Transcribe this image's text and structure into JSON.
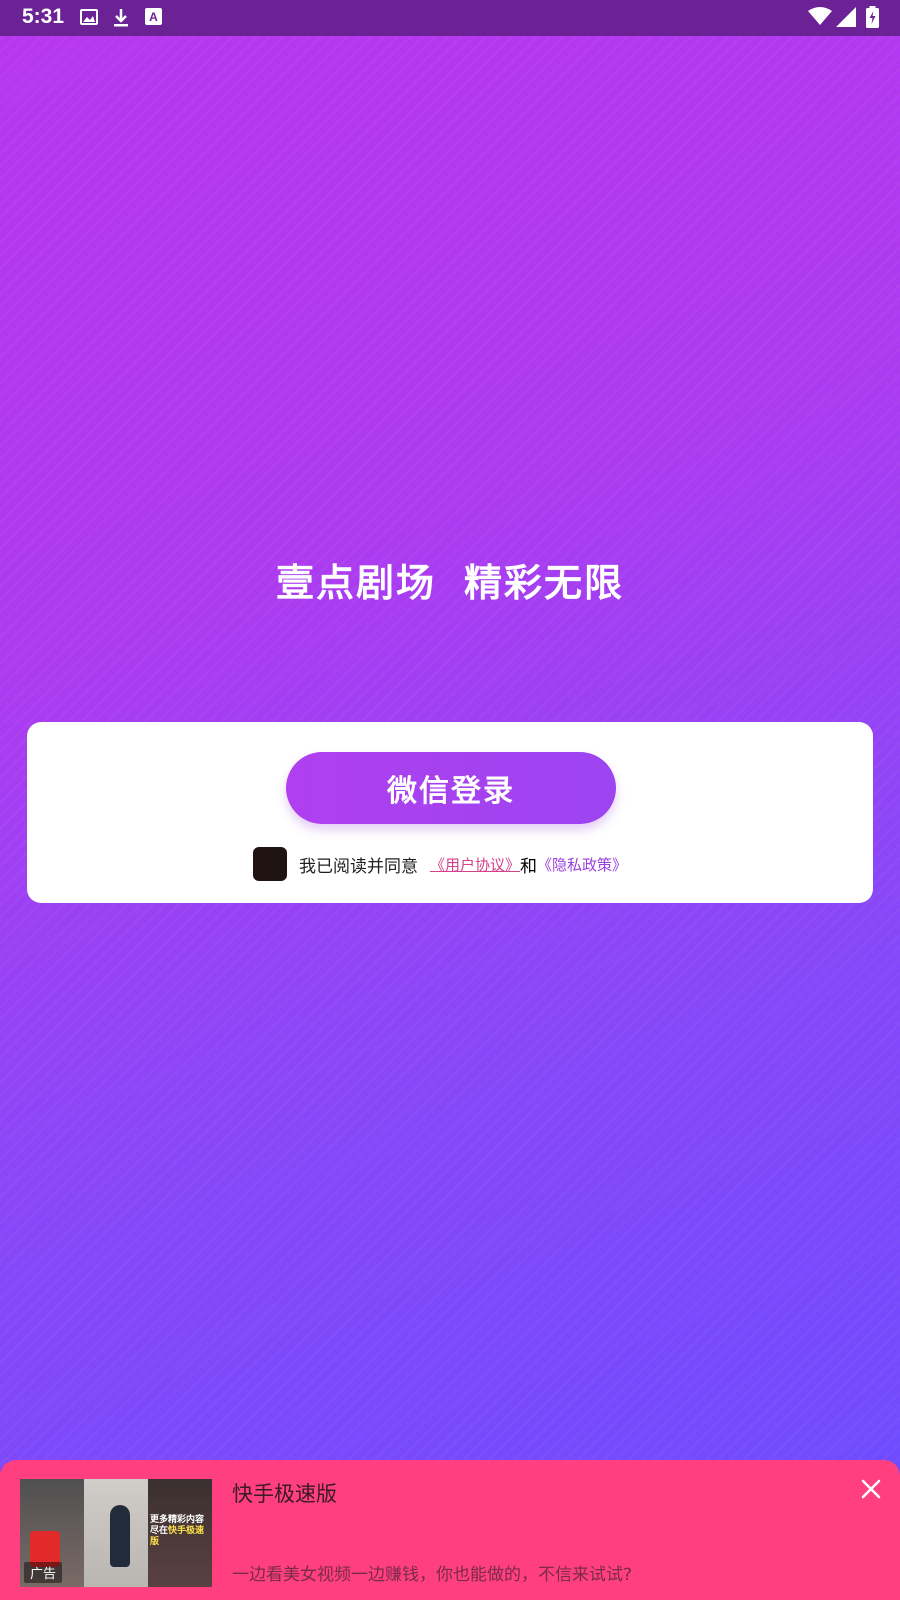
{
  "status_bar": {
    "time": "5:31",
    "left_icons": [
      "image-icon",
      "download-icon",
      "a-icon"
    ],
    "right_icons": [
      "wifi-icon",
      "signal-icon",
      "battery-icon"
    ]
  },
  "tagline": {
    "part1": "壹点剧场",
    "part2": "精彩无限"
  },
  "login": {
    "button_label": "微信登录",
    "agree_text": "我已阅读并同意",
    "user_agreement": "《用户协议》",
    "and": "和",
    "privacy_policy": "《隐私政策》"
  },
  "ad": {
    "title": "快手极速版",
    "description": "一边看美女视频一边赚钱，你也能做的，不信来试试?",
    "thumb_label": "广告",
    "thumb_text_line1": "更多精彩内容",
    "thumb_text_line2_prefix": "尽在",
    "thumb_text_line2_highlight": "快手极速版"
  },
  "colors": {
    "gradient_top": "#b737ef",
    "gradient_bottom": "#6a4dff",
    "ad_background": "#ff3f7f",
    "button_color": "#a940f0",
    "user_agreement_link": "#d6408a",
    "privacy_link": "#9b3fe0"
  }
}
